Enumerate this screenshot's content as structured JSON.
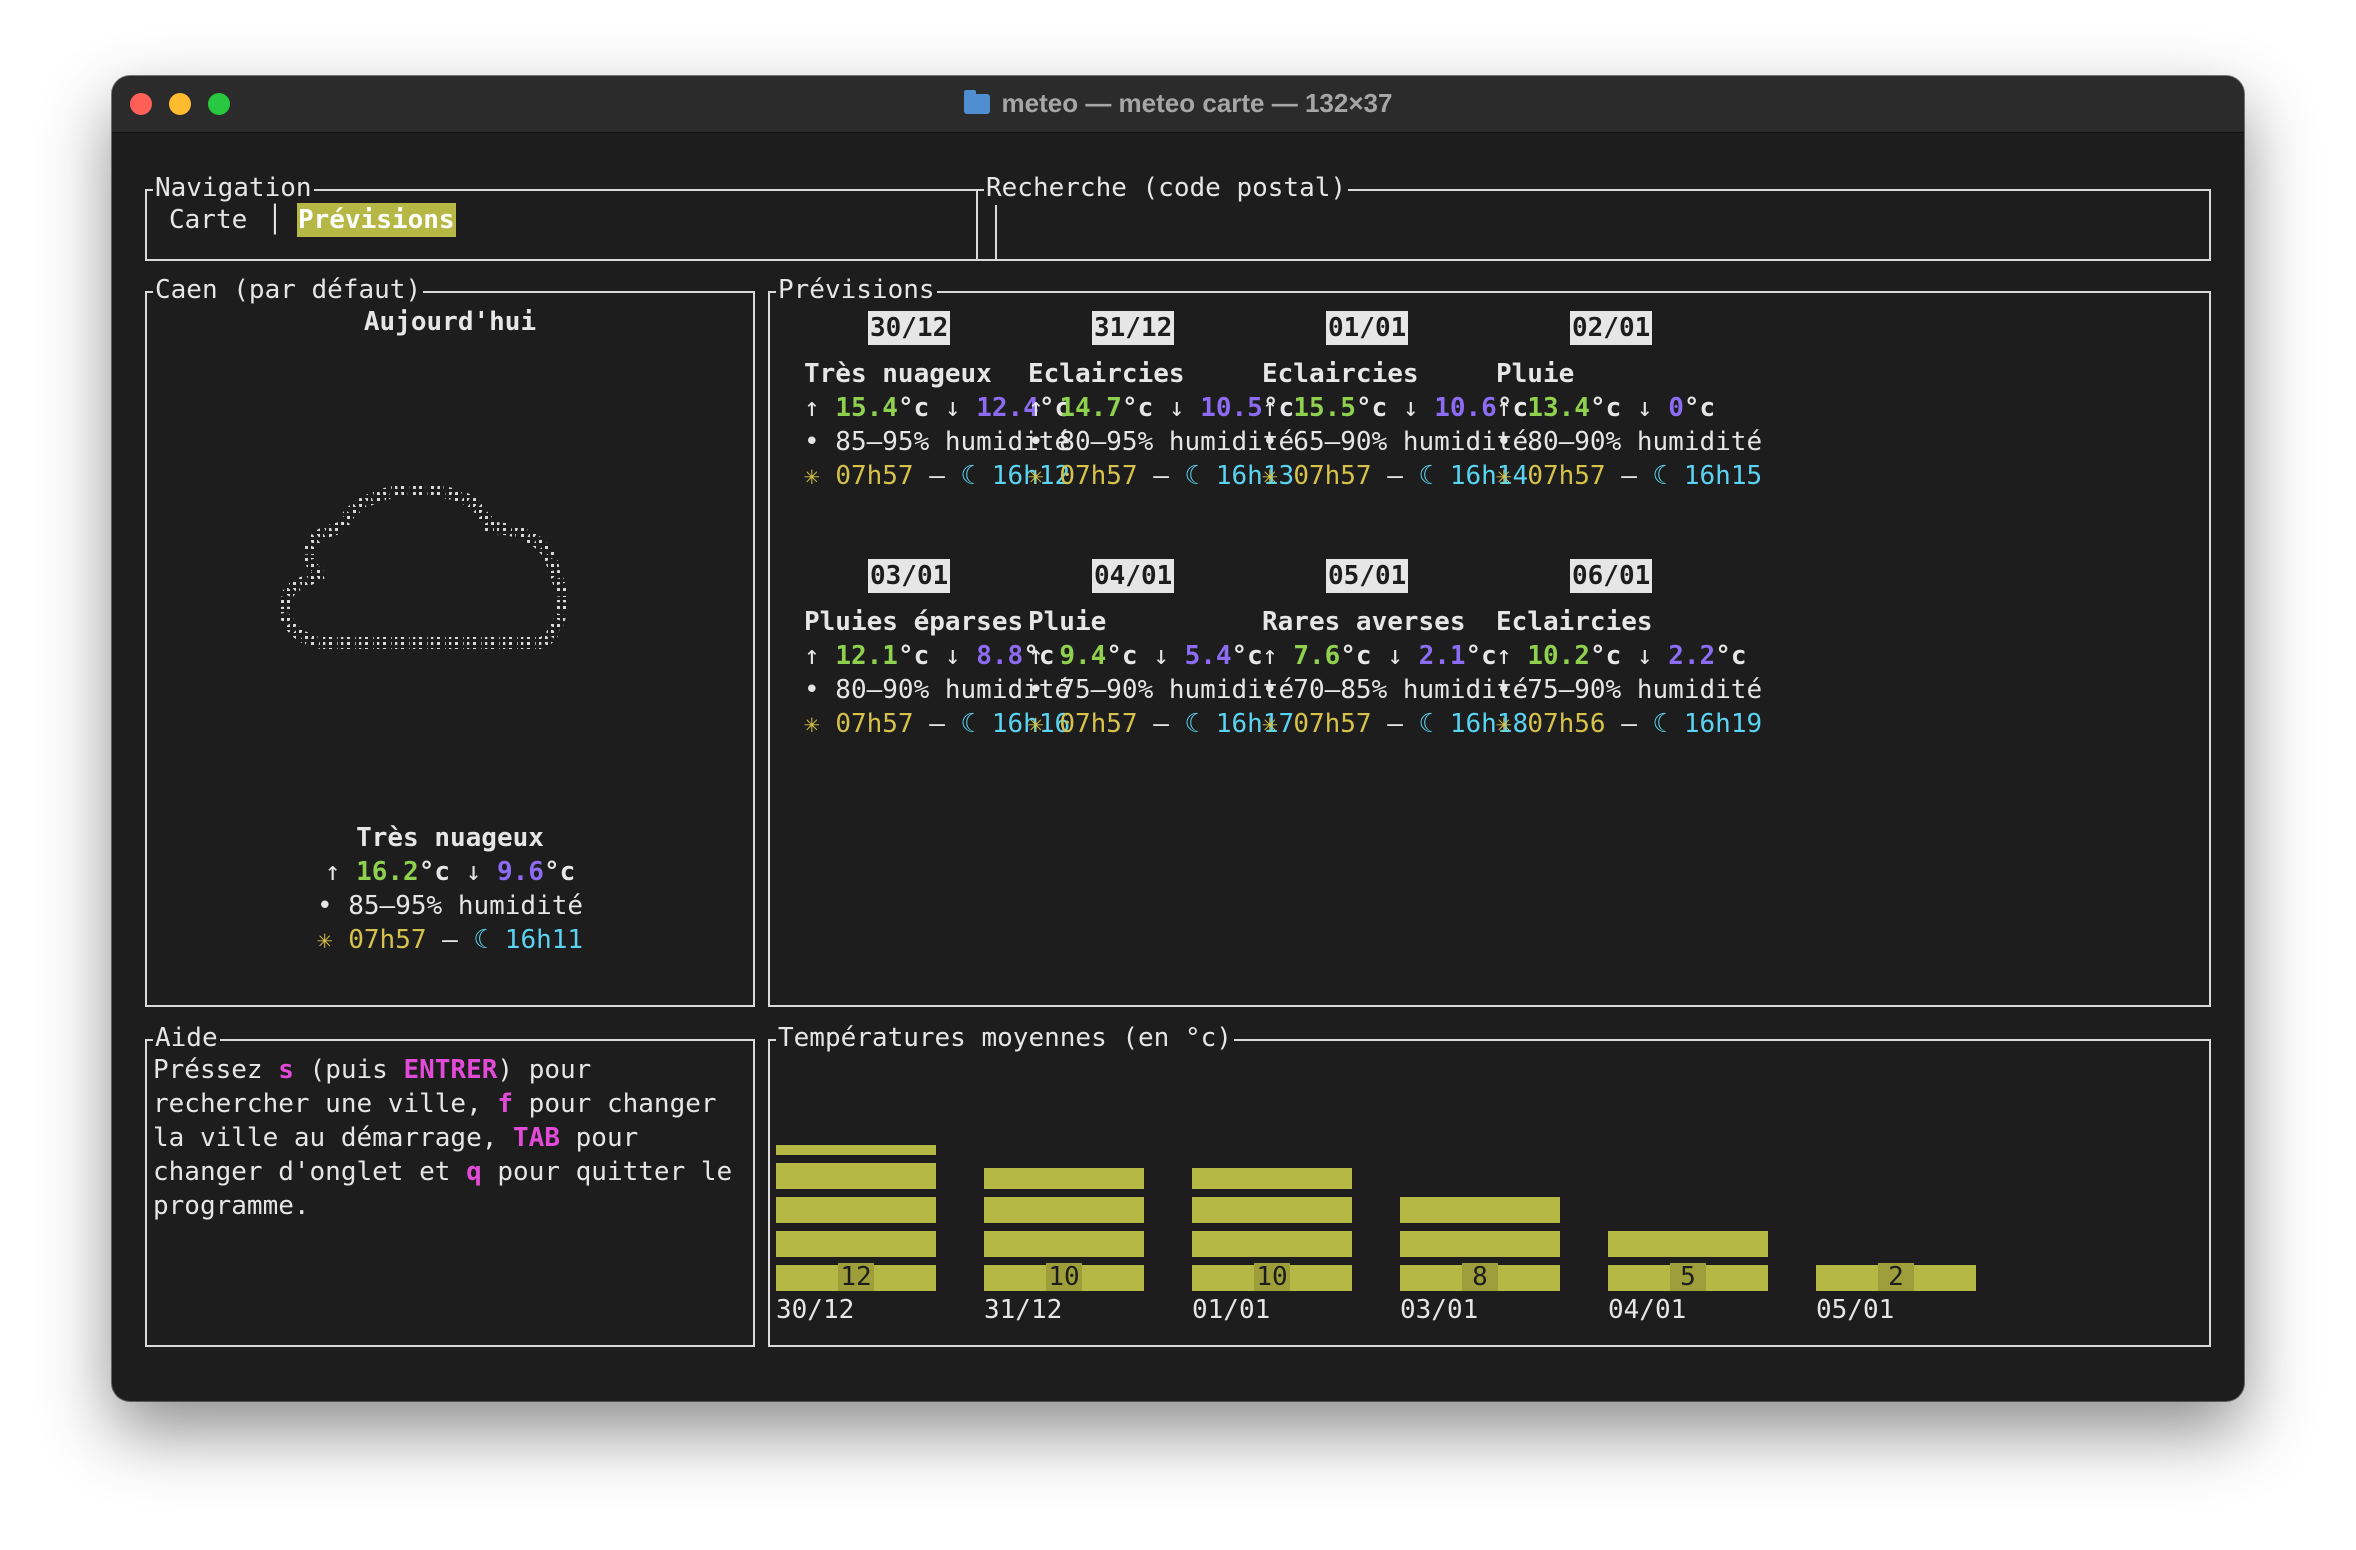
{
  "window": {
    "title": "meteo — meteo carte — 132×37"
  },
  "navigation": {
    "title": "Navigation",
    "tabs": [
      "Carte",
      "Prévisions"
    ],
    "active_tab": "Prévisions",
    "separator": "│"
  },
  "search": {
    "title": "Recherche (code postal)",
    "value": ""
  },
  "today": {
    "panel_title": "Caen (par défaut)",
    "heading": "Aujourd'hui",
    "condition": "Très nuageux",
    "tmax": "16.2",
    "tmin": "9.6",
    "humidity": "85–95% humidité",
    "sunrise": "07h57",
    "sunset": "16h11"
  },
  "forecast": {
    "title": "Prévisions",
    "days": [
      {
        "date": "30/12",
        "condition": "Très nuageux",
        "tmax": "15.4",
        "tmin": "12.4",
        "humidity": "85–95% humidité",
        "sunrise": "07h57",
        "sunset": "16h12"
      },
      {
        "date": "31/12",
        "condition": "Eclaircies",
        "tmax": "14.7",
        "tmin": "10.5",
        "humidity": "80–95% humidité",
        "sunrise": "07h57",
        "sunset": "16h13"
      },
      {
        "date": "01/01",
        "condition": "Eclaircies",
        "tmax": "15.5",
        "tmin": "10.6",
        "humidity": "65–90% humidité",
        "sunrise": "07h57",
        "sunset": "16h14"
      },
      {
        "date": "02/01",
        "condition": "Pluie",
        "tmax": "13.4",
        "tmin": "0",
        "humidity": "80–90% humidité",
        "sunrise": "07h57",
        "sunset": "16h15"
      },
      {
        "date": "03/01",
        "condition": "Pluies éparses",
        "tmax": "12.1",
        "tmin": "8.8",
        "humidity": "80–90% humidité",
        "sunrise": "07h57",
        "sunset": "16h16"
      },
      {
        "date": "04/01",
        "condition": "Pluie",
        "tmax": "9.4",
        "tmin": "5.4",
        "humidity": "75–90% humidité",
        "sunrise": "07h57",
        "sunset": "16h17"
      },
      {
        "date": "05/01",
        "condition": "Rares averses",
        "tmax": "7.6",
        "tmin": "2.1",
        "humidity": "70–85% humidité",
        "sunrise": "07h57",
        "sunset": "16h18"
      },
      {
        "date": "06/01",
        "condition": "Eclaircies",
        "tmax": "10.2",
        "tmin": "2.2",
        "humidity": "75–90% humidité",
        "sunrise": "07h56",
        "sunset": "16h19"
      }
    ]
  },
  "symbols": {
    "up": "↑",
    "down": "↓",
    "deg": "°c",
    "bullet": "•",
    "sun": "✳",
    "moon": "☾",
    "dash": "–"
  },
  "help": {
    "title": "Aide",
    "lines": [
      [
        {
          "t": "Préssez "
        },
        {
          "t": "s",
          "k": 1
        },
        {
          "t": " (puis "
        },
        {
          "t": "ENTRER",
          "k": 1
        },
        {
          "t": ") pour"
        }
      ],
      [
        {
          "t": "rechercher une ville, "
        },
        {
          "t": "f",
          "k": 1
        },
        {
          "t": " pour changer"
        }
      ],
      [
        {
          "t": "la ville au démarrage, "
        },
        {
          "t": "TAB",
          "k": 1
        },
        {
          "t": " pour"
        }
      ],
      [
        {
          "t": "changer d'onglet et "
        },
        {
          "t": "q",
          "k": 1
        },
        {
          "t": " pour quitter le"
        }
      ],
      [
        {
          "t": "programme."
        }
      ]
    ]
  },
  "chart_data": {
    "type": "bar",
    "title": "Températures moyennes (en °c)",
    "categories": [
      "30/12",
      "31/12",
      "01/01",
      "03/01",
      "04/01",
      "05/01"
    ],
    "values": [
      12,
      10,
      10,
      8,
      5,
      2
    ],
    "ylim": [
      0,
      13
    ],
    "bar_color": "#b6b845"
  },
  "colors": {
    "background": "#1d1d1d",
    "text": "#e6e6e6",
    "max_temp": "#8fd14f",
    "min_temp": "#8b6cf2",
    "sun": "#d6c24a",
    "moon": "#5ad4f2",
    "key": "#e24ad8",
    "highlight": "#b6b845"
  }
}
